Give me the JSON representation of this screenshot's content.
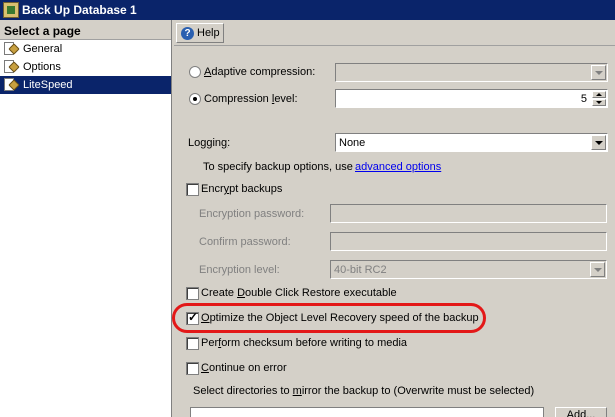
{
  "window": {
    "title": "Back Up Database 1"
  },
  "sidebar": {
    "header": "Select a page",
    "items": [
      {
        "label": "General",
        "selected": false
      },
      {
        "label": "Options",
        "selected": false
      },
      {
        "label": "LiteSpeed",
        "selected": true
      }
    ]
  },
  "toolbar": {
    "help_label": "Help"
  },
  "form": {
    "adaptive_compression": {
      "pre": "",
      "accel": "A",
      "post": "daptive compression:",
      "checked": false,
      "value": ""
    },
    "compression_level": {
      "pre": "Compression ",
      "accel": "l",
      "post": "evel:",
      "checked": true,
      "value": "5"
    },
    "logging": {
      "pre": "Loggin",
      "accel": "g",
      "post": ":",
      "value": "None"
    },
    "advanced_hint": "To specify backup options, use",
    "advanced_link": "advanced options",
    "encrypt_backups": {
      "pre": "Encr",
      "accel": "y",
      "post": "pt backups",
      "checked": false
    },
    "encryption_password": {
      "label": "Encryption password:",
      "value": ""
    },
    "confirm_password": {
      "label": "Confirm password:",
      "value": ""
    },
    "encryption_level": {
      "label": "Encryption level:",
      "value": "40-bit RC2"
    },
    "double_click_restore": {
      "pre": "Create ",
      "accel": "D",
      "post": "ouble Click Restore executable",
      "checked": false
    },
    "olr_optimize": {
      "pre": "",
      "accel": "O",
      "post": "ptimize the Object Level Recovery speed of the backup",
      "checked": true
    },
    "checksum": {
      "pre": "Per",
      "accel": "f",
      "post": "orm checksum before writing to media",
      "checked": false
    },
    "continue_on_error": {
      "pre": "",
      "accel": "C",
      "post": "ontinue on error",
      "checked": false
    },
    "mirror": {
      "pre": "Select directories to ",
      "accel": "m",
      "post": "irror the backup to (Overwrite must be selected)"
    },
    "add_label": "Add..."
  },
  "colors": {
    "highlight": "#e31818",
    "selection": "#0a246a",
    "link": "#0000ee"
  }
}
